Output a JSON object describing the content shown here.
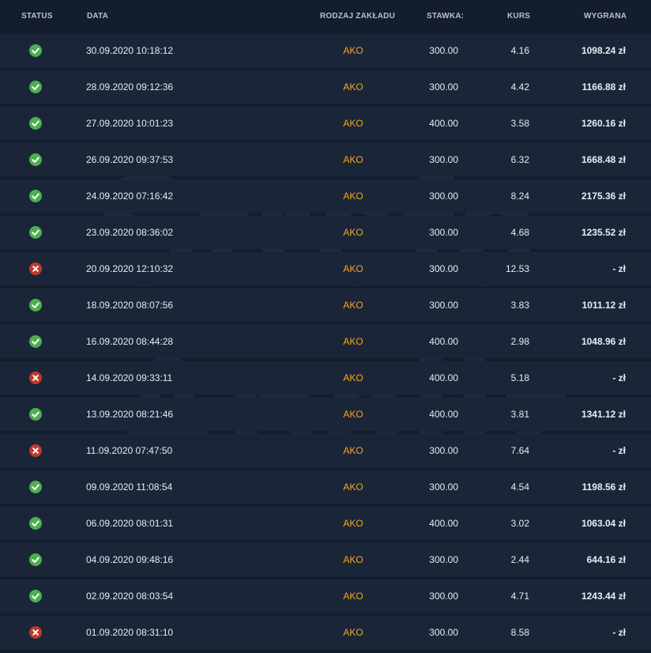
{
  "headers": {
    "status": "STATUS",
    "date": "DATA",
    "bet_type": "RODZAJ ZAKŁADU",
    "stake": "STAWKA:",
    "odds": "KURS",
    "winnings": "WYGRANA"
  },
  "colors": {
    "background": "#131d2d",
    "row": "#1a2638",
    "bet_type": "#f5a623",
    "win_icon": "#4caf50",
    "loss_icon": "#c0392b"
  },
  "icons": {
    "win": "check-circle-icon",
    "loss": "x-circle-icon"
  },
  "rows": [
    {
      "status": "win",
      "date": "30.09.2020 10:18:12",
      "type": "AKO",
      "stake": "300.00",
      "odds": "4.16",
      "winnings": "1098.24 zł"
    },
    {
      "status": "win",
      "date": "28.09.2020 09:12:36",
      "type": "AKO",
      "stake": "300.00",
      "odds": "4.42",
      "winnings": "1166.88 zł"
    },
    {
      "status": "win",
      "date": "27.09.2020 10:01:23",
      "type": "AKO",
      "stake": "400.00",
      "odds": "3.58",
      "winnings": "1260.16 zł"
    },
    {
      "status": "win",
      "date": "26.09.2020 09:37:53",
      "type": "AKO",
      "stake": "300.00",
      "odds": "6.32",
      "winnings": "1668.48 zł"
    },
    {
      "status": "win",
      "date": "24.09.2020 07:16:42",
      "type": "AKO",
      "stake": "300.00",
      "odds": "8.24",
      "winnings": "2175.36 zł"
    },
    {
      "status": "win",
      "date": "23.09.2020 08:36:02",
      "type": "AKO",
      "stake": "300.00",
      "odds": "4.68",
      "winnings": "1235.52 zł"
    },
    {
      "status": "loss",
      "date": "20.09.2020 12:10:32",
      "type": "AKO",
      "stake": "300.00",
      "odds": "12.53",
      "winnings": "- zł"
    },
    {
      "status": "win",
      "date": "18.09.2020 08:07:56",
      "type": "AKO",
      "stake": "300.00",
      "odds": "3.83",
      "winnings": "1011.12 zł"
    },
    {
      "status": "win",
      "date": "16.09.2020 08:44:28",
      "type": "AKO",
      "stake": "400.00",
      "odds": "2.98",
      "winnings": "1048.96 zł"
    },
    {
      "status": "loss",
      "date": "14.09.2020 09:33:11",
      "type": "AKO",
      "stake": "400.00",
      "odds": "5.18",
      "winnings": "- zł"
    },
    {
      "status": "win",
      "date": "13.09.2020 08:21:46",
      "type": "AKO",
      "stake": "400.00",
      "odds": "3.81",
      "winnings": "1341.12 zł"
    },
    {
      "status": "loss",
      "date": "11.09.2020 07:47:50",
      "type": "AKO",
      "stake": "300.00",
      "odds": "7.64",
      "winnings": "- zł"
    },
    {
      "status": "win",
      "date": "09.09.2020 11:08:54",
      "type": "AKO",
      "stake": "300.00",
      "odds": "4.54",
      "winnings": "1198.56 zł"
    },
    {
      "status": "win",
      "date": "06.09.2020 08:01:31",
      "type": "AKO",
      "stake": "400.00",
      "odds": "3.02",
      "winnings": "1063.04 zł"
    },
    {
      "status": "win",
      "date": "04.09.2020 09:48:16",
      "type": "AKO",
      "stake": "300.00",
      "odds": "2.44",
      "winnings": "644.16 zł"
    },
    {
      "status": "win",
      "date": "02.09.2020 08:03:54",
      "type": "AKO",
      "stake": "300.00",
      "odds": "4.71",
      "winnings": "1243.44 zł"
    },
    {
      "status": "loss",
      "date": "01.09.2020 08:31:10",
      "type": "AKO",
      "stake": "300.00",
      "odds": "8.58",
      "winnings": "- zł"
    }
  ],
  "watermark": {
    "line1": "Strefa",
    "line2": "Analiz"
  }
}
